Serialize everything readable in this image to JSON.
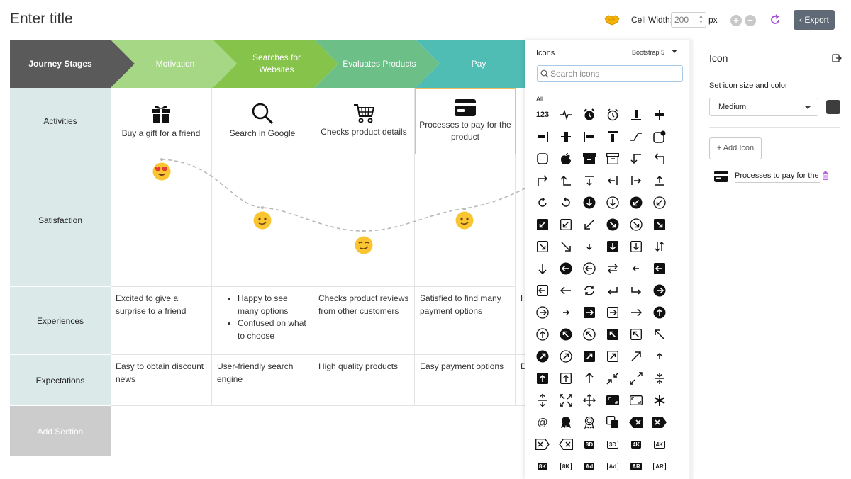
{
  "header": {
    "title": "Enter title",
    "cell_width_label": "Cell Width:",
    "cell_width_value": "200",
    "cell_width_unit": "px",
    "export_label": "Export",
    "export_chevron": "‹"
  },
  "stages": {
    "header_label": "Journey Stages",
    "items": [
      {
        "label": "Motivation",
        "color": "#a6d785"
      },
      {
        "label": "Searches for Websites",
        "color": "#86c34a"
      },
      {
        "label": "Evaluates Products",
        "color": "#6cbf86"
      },
      {
        "label": "Pay",
        "color": "#4fbdb3"
      }
    ],
    "header_color": "#5a5a5a"
  },
  "rows": {
    "activities": "Activities",
    "satisfaction": "Satisfaction",
    "experiences": "Experiences",
    "expectations": "Expectations",
    "add_section": "Add Section"
  },
  "activities": [
    {
      "icon": "gift-icon",
      "text": "Buy a gift for a friend"
    },
    {
      "icon": "search-icon",
      "text": "Search in Google"
    },
    {
      "icon": "cart-icon",
      "text": "Checks product details"
    },
    {
      "icon": "credit-card-icon",
      "text": "Processes to pay for the product"
    }
  ],
  "satisfaction": [
    {
      "emoji": "heart-eyes-face",
      "level": 1.0
    },
    {
      "emoji": "smiling-face",
      "level": 0.5
    },
    {
      "emoji": "smirking-face",
      "level": 0.3
    },
    {
      "emoji": "smiling-face",
      "level": 0.5
    }
  ],
  "experiences": {
    "col1": "Excited to give a surprise to a friend",
    "col2_items": [
      "Happy to see many options",
      "Confused on what to choose"
    ],
    "col3": "Checks product reviews from other customers",
    "col4": "Satisfied to find many payment options",
    "col5_partial": "H"
  },
  "expectations": {
    "col1": "Easy to obtain discount news",
    "col2": "User-friendly search engine",
    "col3": "High quality products",
    "col4": "Easy payment options",
    "col5_partial": "D"
  },
  "icon_picker": {
    "title": "Icons",
    "library": "Bootstrap 5",
    "search_placeholder": "Search icons",
    "category": "All",
    "text_icons": {
      "num": "123",
      "bad1": "3D",
      "bad2": "3D",
      "bad3": "4K",
      "bad4": "4K",
      "bad5": "8K",
      "bad6": "8K",
      "bad7": "Ad",
      "bad8": "Ad",
      "bad9": "AR",
      "bad10": "AR",
      "at": "@"
    }
  },
  "icon_panel": {
    "title": "Icon",
    "size_color_label": "Set icon size and color",
    "size_value": "Medium",
    "color": "#3d3d3d",
    "add_icon_label": "+ Add Icon",
    "item_text": "Processes to pay for the product"
  }
}
